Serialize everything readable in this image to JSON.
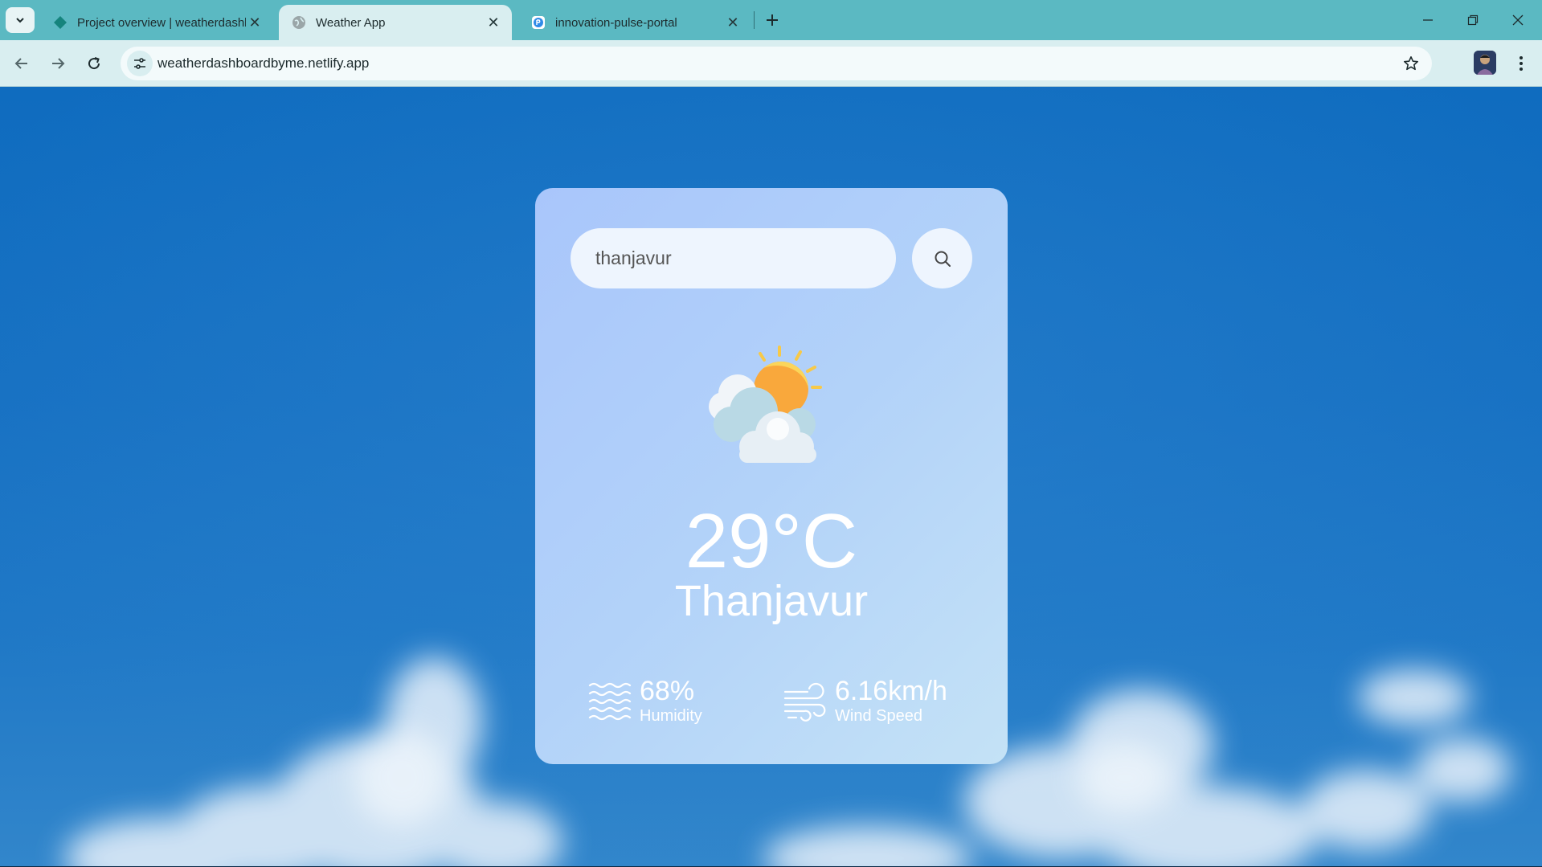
{
  "browser": {
    "tabs": [
      {
        "title": "Project overview | weatherdashb",
        "active": false
      },
      {
        "title": "Weather App",
        "active": true
      },
      {
        "title": "innovation-pulse-portal",
        "active": false
      }
    ],
    "url": "weatherdashboardbyme.netlify.app"
  },
  "app": {
    "search": {
      "value": "thanjavur"
    },
    "weather": {
      "condition_icon": "partly-cloudy-icon",
      "temperature": "29°C",
      "city": "Thanjavur"
    },
    "humidity": {
      "value": "68%",
      "label": "Humidity",
      "icon": "humidity-icon"
    },
    "wind": {
      "value": "6.16km/h",
      "label": "Wind Speed",
      "icon": "wind-icon"
    }
  },
  "colors": {
    "tabstrip": "#5bb9c2",
    "toolbar": "#d9eef0",
    "sky": "#1670c2",
    "card_start": "#a9c6fb",
    "card_end": "#c4e2f6",
    "sun": "#f7a937"
  }
}
